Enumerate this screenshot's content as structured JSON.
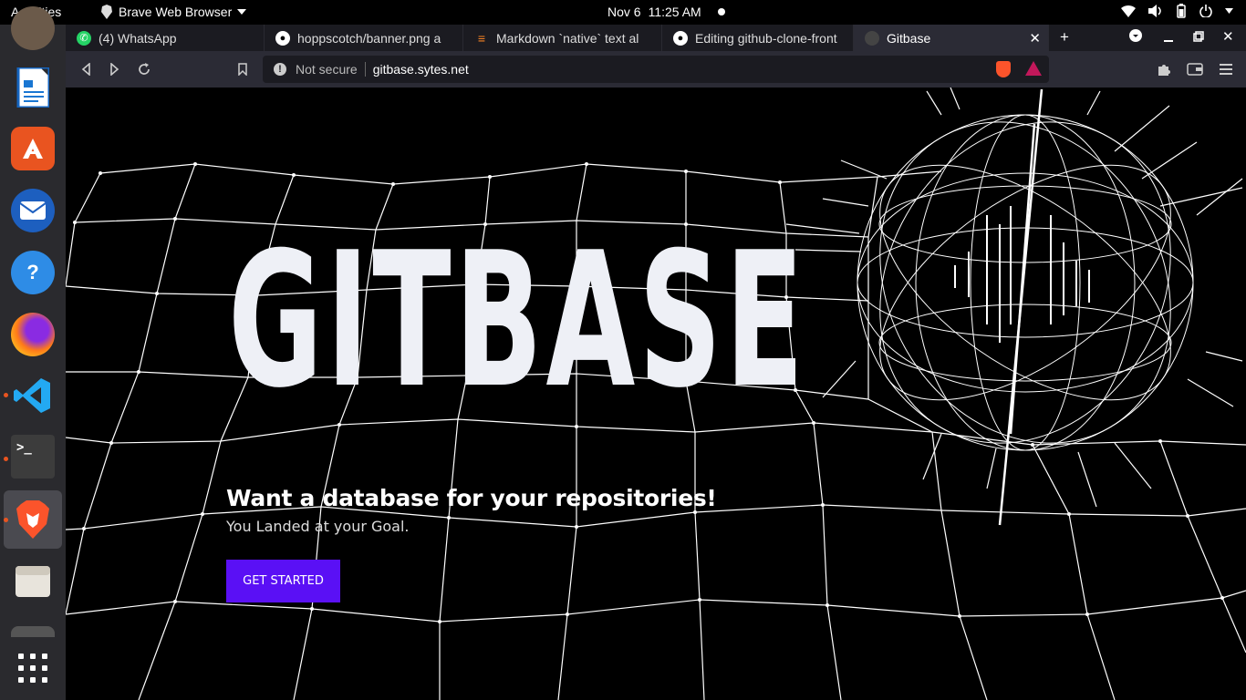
{
  "topbar": {
    "activities": "Activities",
    "app_name": "Brave Web Browser",
    "date": "Nov 6",
    "time": "11:25 AM"
  },
  "dock": {
    "apps": [
      {
        "name": "libreoffice-writer-icon"
      },
      {
        "name": "ubuntu-software-icon"
      },
      {
        "name": "thunderbird-icon"
      },
      {
        "name": "help-icon"
      },
      {
        "name": "firefox-icon"
      },
      {
        "name": "vscode-icon"
      },
      {
        "name": "terminal-icon"
      },
      {
        "name": "brave-icon"
      },
      {
        "name": "files-icon"
      },
      {
        "name": "show-apps-icon"
      }
    ],
    "help_glyph": "?",
    "terminal_glyph": ">_"
  },
  "tabs": [
    {
      "title": "(4) WhatsApp",
      "favicon": "whatsapp-icon"
    },
    {
      "title": "hoppscotch/banner.png a",
      "favicon": "github-icon"
    },
    {
      "title": "Markdown `native` text al",
      "favicon": "stackoverflow-icon"
    },
    {
      "title": "Editing github-clone-front",
      "favicon": "github-icon"
    },
    {
      "title": "Gitbase",
      "favicon": "gitbase-icon"
    }
  ],
  "toolbar": {
    "not_secure": "Not secure",
    "url": "gitbase.sytes.net"
  },
  "hero": {
    "title": "GITBASE",
    "subtitle": "Want a database for your repositories!",
    "description": "You Landed at your Goal.",
    "cta": "GET STARTED"
  },
  "colors": {
    "accent": "#5a10f5",
    "background": "#000000",
    "title": "#eef0f6"
  }
}
